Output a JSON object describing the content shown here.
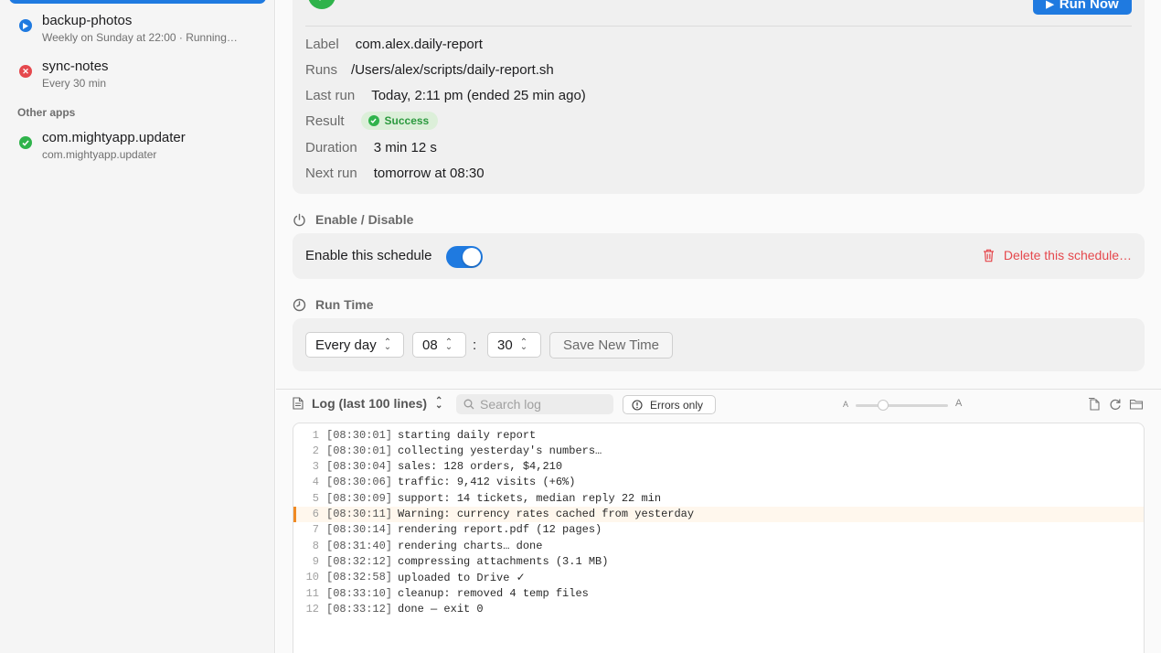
{
  "sidebar": {
    "items": [
      {
        "name": "backup-photos",
        "sub": "Weekly on Sunday at 22:00 · Running…",
        "status": "running",
        "color": "#1f7ae0"
      },
      {
        "name": "sync-notes",
        "sub": "Every 30 min",
        "status": "failed",
        "color": "#e5484d"
      }
    ],
    "section": "Other apps",
    "other_items": [
      {
        "name": "com.mightyapp.updater",
        "sub": "com.mightyapp.updater",
        "status": "ok",
        "color": "#2fb34b"
      }
    ]
  },
  "summary": {
    "status": "OK",
    "run_now": "Run Now",
    "label_key": "Label",
    "label_val": "com.alex.daily-report",
    "runs_key": "Runs",
    "runs_val": "/Users/alex/scripts/daily-report.sh",
    "last_key": "Last run",
    "last_val": "Today, 2:11 pm (ended 25 min ago)",
    "result_key": "Result",
    "result_val": "Success",
    "duration_key": "Duration",
    "duration_val": "3 min 12 s",
    "next_key": "Next run",
    "next_val": "tomorrow at 08:30"
  },
  "enable": {
    "heading": "Enable / Disable",
    "label": "Enable this schedule",
    "enabled": true,
    "delete": "Delete this schedule…"
  },
  "run_time": {
    "heading": "Run Time",
    "frequency": "Every day",
    "hour": "08",
    "separator": ":",
    "minute": "30",
    "save": "Save New Time"
  },
  "log": {
    "title": "Log (last 100 lines)",
    "search_placeholder": "Search log",
    "errors_only": "Errors only",
    "zoom_small": "A",
    "zoom_large": "A",
    "zoom_level": 0.27,
    "lines": [
      {
        "n": "1",
        "t": "[08:30:01]",
        "msg": "starting daily report"
      },
      {
        "n": "2",
        "t": "[08:30:01]",
        "msg": "collecting yesterday's numbers…"
      },
      {
        "n": "3",
        "t": "[08:30:04]",
        "msg": "sales: 128 orders, $4,210"
      },
      {
        "n": "4",
        "t": "[08:30:06]",
        "msg": "traffic: 9,412 visits (+6%)"
      },
      {
        "n": "5",
        "t": "[08:30:09]",
        "msg": "support: 14 tickets, median reply 22 min"
      },
      {
        "n": "6",
        "t": "[08:30:11]",
        "msg": "Warning: currency rates cached from yesterday"
      },
      {
        "n": "7",
        "t": "[08:30:14]",
        "msg": "rendering report.pdf (12 pages)"
      },
      {
        "n": "8",
        "t": "[08:31:40]",
        "msg": "rendering charts… done"
      },
      {
        "n": "9",
        "t": "[08:32:12]",
        "msg": "compressing attachments (3.1 MB)"
      },
      {
        "n": "10",
        "t": "[08:32:58]",
        "msg": "uploaded to Drive ✓"
      },
      {
        "n": "11",
        "t": "[08:33:10]",
        "msg": "cleanup: removed 4 temp files"
      },
      {
        "n": "12",
        "t": "[08:33:12]",
        "msg": "done — exit 0"
      }
    ],
    "warning_index": 5
  },
  "colors": {
    "accent": "#1f7ae0",
    "success": "#2fb34b",
    "danger": "#e5484d",
    "warning": "#f08a24"
  }
}
